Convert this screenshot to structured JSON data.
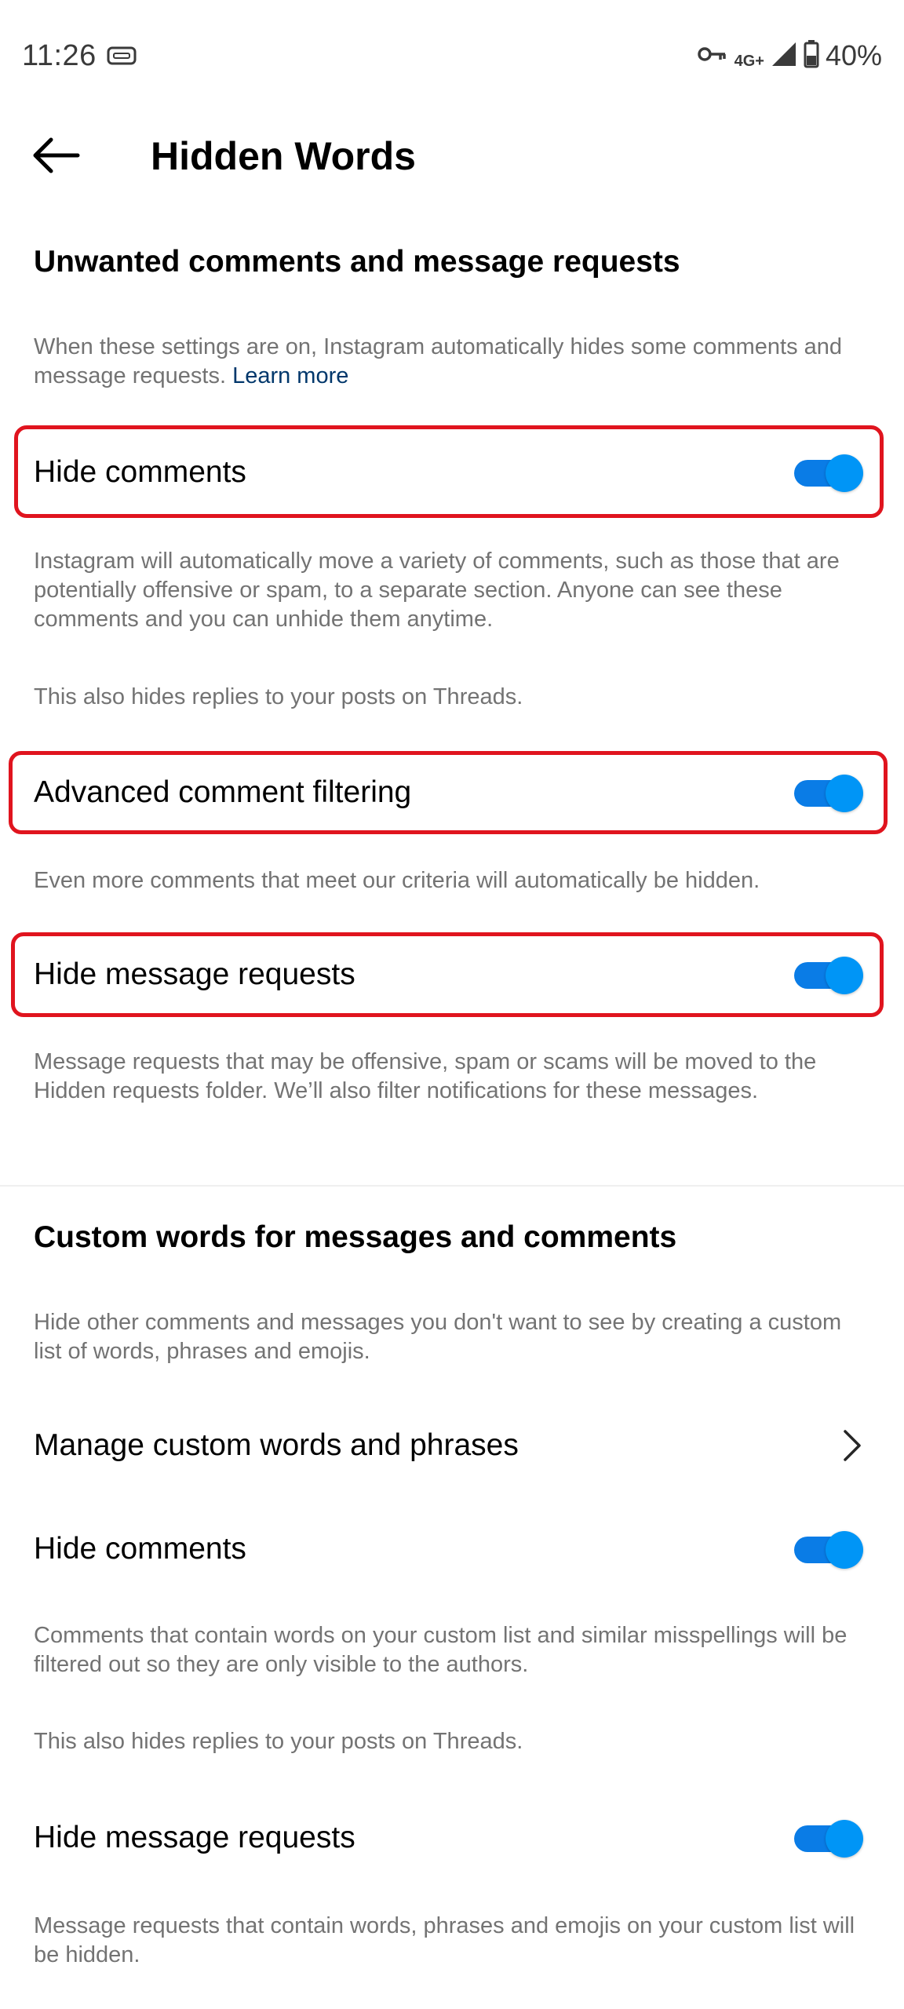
{
  "status_bar": {
    "time": "11:26",
    "network": "4G+",
    "battery": "40%",
    "icons": [
      "vpn-icon",
      "key-icon",
      "signal-icon",
      "battery-icon"
    ]
  },
  "header": {
    "title": "Hidden Words",
    "back_icon": "arrow-left-icon"
  },
  "section1": {
    "title": "Unwanted comments and message requests",
    "description": "When these settings are on, Instagram automatically hides some comments and message requests.",
    "learn_more": "Learn more",
    "hide_comments": {
      "label": "Hide comments",
      "enabled": true,
      "description": "Instagram will automatically move a variety of comments, such as those that are potentially offensive or spam, to a separate section. Anyone can see these comments and you can unhide them anytime.",
      "threads_note": "This also hides replies to your posts on Threads."
    },
    "advanced_filtering": {
      "label": "Advanced comment filtering",
      "enabled": true,
      "description": "Even more comments that meet our criteria will automatically be hidden."
    },
    "hide_message_requests": {
      "label": "Hide message requests",
      "enabled": true,
      "description": "Message requests that may be offensive, spam or scams will be moved to the Hidden requests folder. We’ll also filter notifications for these messages."
    }
  },
  "section2": {
    "title": "Custom words for messages and comments",
    "description": "Hide other comments and messages you don't want to see by creating a custom list of words, phrases and emojis.",
    "manage_link": "Manage custom words and phrases",
    "hide_comments": {
      "label": "Hide comments",
      "enabled": true,
      "description": "Comments that contain words on your custom list and similar misspellings will be filtered out so they are only visible to the authors.",
      "threads_note": "This also hides replies to your posts on Threads."
    },
    "hide_message_requests": {
      "label": "Hide message requests",
      "enabled": true,
      "description": "Message requests that contain words, phrases and emojis on your custom list will be hidden."
    }
  },
  "colors": {
    "toggle_on": "#0095f6",
    "highlight": "#e0141e",
    "link": "#00376b",
    "secondary_text": "#737373"
  }
}
